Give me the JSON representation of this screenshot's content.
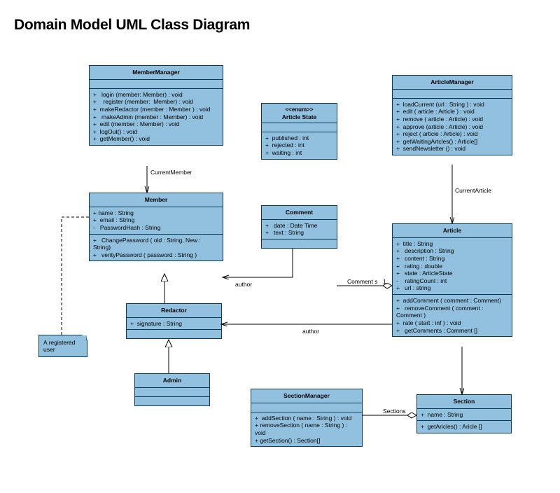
{
  "title": "Domain Model UML Class Diagram",
  "classes": {
    "MemberManager": {
      "name": "MemberManager",
      "methods": [
        "+   login (member: Member) : void",
        "+    register (member:  Member) : void",
        "+  makeRedactor (member : Member ) : void",
        "+   makeAdmin (member : Member) : void",
        "+  edit (member : Member) : void",
        "+  logOut() : void",
        "+  getMember() : void"
      ]
    },
    "ArticleState": {
      "stereotype": "<<enum>>",
      "name": "Article State",
      "attrs": [
        "+  published : int",
        "+  rejected : int",
        "+  waiting : int"
      ]
    },
    "ArticleManager": {
      "name": "ArticleManager",
      "methods": [
        "+  loadCurrent (url : String ) : void",
        "+  edit ( article : Article ) : void",
        "+  remove ( article : Article) : void",
        "+  approve (article : Article) : void",
        "+  reject ( article : Article) : void",
        "+  getWaitingArtcles() : Article[]",
        "+  sendNewsletter () : void"
      ]
    },
    "Member": {
      "name": "Member",
      "attrs": [
        "+ name : String",
        "+  email : String",
        "-   PasswordHash : String"
      ],
      "methods": [
        "+   ChangePassword ( old : String, New : String)",
        "+   verityPassword ( password : String )"
      ]
    },
    "Comment": {
      "name": "Comment",
      "attrs": [
        "+   date : Date Time",
        "+   text : String"
      ]
    },
    "Article": {
      "name": "Article",
      "attrs": [
        "+  title : String",
        "+   description : String",
        "+   content : String",
        "+   rating : double",
        "+   state : ArticleState",
        "-    ratingCount : int",
        "+   url : string"
      ],
      "methods": [
        "+  addComment ( comment : Comment)",
        "+   removeComment ( comment : Comment )",
        "+  rate ( start : inf ) : void",
        "+   getComments : Comment []"
      ]
    },
    "Redactor": {
      "name": "Redactor",
      "attrs": [
        "+  signature : String"
      ]
    },
    "Admin": {
      "name": "Admin"
    },
    "SectionManager": {
      "name": "SectionManager",
      "methods": [
        "+  addSection ( name : String ) : void",
        "+ removeSection ( name : String ) : void",
        "+ getSection() : Section[]"
      ]
    },
    "Section": {
      "name": "Section",
      "attrs": [
        "+  name : String"
      ],
      "methods": [
        "+  getAricles() : Aricle []"
      ]
    }
  },
  "note": "A registered user",
  "labels": {
    "currentMember": "CurrentMember",
    "currentArticle": "CurrentArticle",
    "author1": "author",
    "author2": "author",
    "comments": "Comment\ns",
    "one": "1",
    "sections": "Sections"
  }
}
